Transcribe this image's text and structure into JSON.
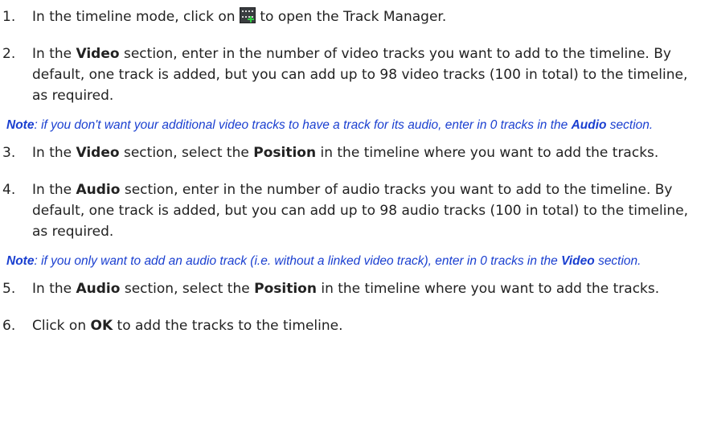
{
  "steps": [
    {
      "num": "1.",
      "pre": "In the timeline mode, click on",
      "post": "to open the Track Manager.",
      "icon": "track-manager-icon"
    },
    {
      "num": "2.",
      "t1": "In the",
      "b1": "Video",
      "t2": "section, enter in the number of video tracks you want to add to the timeline. By default, one track is added, but you can add up to 98 video tracks (100 in total) to the timeline, as required."
    },
    {
      "num": "3.",
      "t1": "In the",
      "b1": "Video",
      "t2": "section, select the",
      "b2": "Position",
      "t3": "in the timeline where you want to add the tracks."
    },
    {
      "num": "4.",
      "t1": "In the",
      "b1": "Audio",
      "t2": "section, enter in the number of audio tracks you want to add to the timeline. By default, one track is added, but you can add up to 98 audio tracks (100 in total) to the timeline, as required."
    },
    {
      "num": "5.",
      "t1": "In the",
      "b1": "Audio",
      "t2": "section, select the",
      "b2": "Position",
      "t3": "in the timeline where you want to add the tracks."
    },
    {
      "num": "6.",
      "t1": "Click on",
      "b1": "OK",
      "t2": "to add the tracks to the timeline."
    }
  ],
  "notes": [
    {
      "label": "Note",
      "t1": ": if you don't want your additional video tracks to have a track for its audio, enter in 0 tracks in the",
      "b1": "Audio",
      "t2": "section."
    },
    {
      "label": "Note",
      "t1": ": if you only want to add an audio track (i.e. without a linked video track), enter in 0 tracks in the",
      "b1": "Video",
      "t2": "section."
    }
  ],
  "colors": {
    "note_text": "#1a3fd0",
    "body_text": "#222222"
  }
}
